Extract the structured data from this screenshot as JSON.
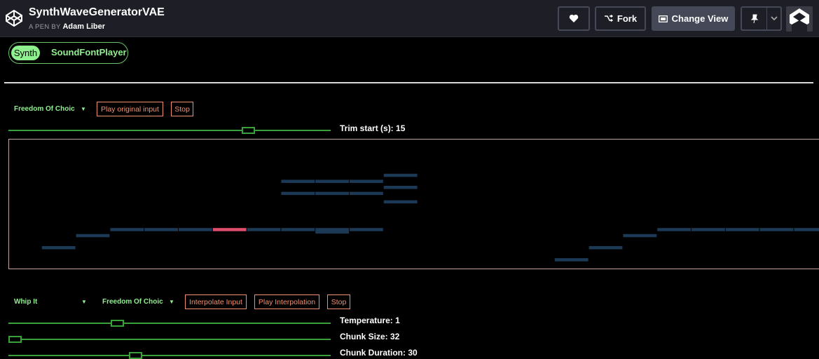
{
  "header": {
    "title": "SynthWaveGeneratorVAE",
    "byline_prefix": "A PEN BY",
    "author": "Adam Liber",
    "fork_label": "Fork",
    "change_view_label": "Change View"
  },
  "tabs": [
    {
      "label": "Synth",
      "active": true
    },
    {
      "label": "SoundFontPlayer",
      "active": false
    }
  ],
  "input_section": {
    "song_select": "Freedom Of Choic",
    "play_button": "Play original input",
    "stop_button": "Stop",
    "trim_label": "Trim start (s): 15",
    "trim_value": 15
  },
  "piano_roll": {
    "note_color": "#1c3a56",
    "highlight_color": "#e0506c",
    "notes": [
      {
        "start": 1,
        "dur": 1,
        "row": 15
      },
      {
        "start": 2,
        "dur": 1,
        "row": 13
      },
      {
        "start": 3,
        "dur": 1,
        "row": 12
      },
      {
        "start": 4,
        "dur": 1,
        "row": 12
      },
      {
        "start": 5,
        "dur": 1,
        "row": 12
      },
      {
        "start": 6,
        "dur": 1,
        "row": 12,
        "highlight": true
      },
      {
        "start": 7,
        "dur": 1,
        "row": 12
      },
      {
        "start": 8,
        "dur": 1,
        "row": 12
      },
      {
        "start": 9,
        "dur": 1,
        "row": 12
      },
      {
        "start": 9,
        "dur": 1,
        "row": 12.4
      },
      {
        "start": 10,
        "dur": 1,
        "row": 12
      },
      {
        "start": 8,
        "dur": 1,
        "row": 4
      },
      {
        "start": 9,
        "dur": 1,
        "row": 4
      },
      {
        "start": 10,
        "dur": 1,
        "row": 4
      },
      {
        "start": 8,
        "dur": 1,
        "row": 6
      },
      {
        "start": 9,
        "dur": 1,
        "row": 6
      },
      {
        "start": 10,
        "dur": 1,
        "row": 6
      },
      {
        "start": 11,
        "dur": 1,
        "row": 3
      },
      {
        "start": 11,
        "dur": 1,
        "row": 5
      },
      {
        "start": 11,
        "dur": 1,
        "row": 7.4
      },
      {
        "start": 16,
        "dur": 1,
        "row": 17
      },
      {
        "start": 17,
        "dur": 1,
        "row": 15
      },
      {
        "start": 18,
        "dur": 1,
        "row": 13
      },
      {
        "start": 19,
        "dur": 1,
        "row": 12
      },
      {
        "start": 20,
        "dur": 1,
        "row": 12
      },
      {
        "start": 21,
        "dur": 1,
        "row": 12
      },
      {
        "start": 22,
        "dur": 1,
        "row": 12
      },
      {
        "start": 23,
        "dur": 1,
        "row": 12
      }
    ]
  },
  "interp_section": {
    "song_a": "Whip It",
    "song_b": "Freedom Of Choic",
    "interpolate_button": "Interpolate Input",
    "play_button": "Play Interpolation",
    "stop_button": "Stop",
    "temperature_label": "Temperature: 1",
    "temperature_value": 0.33,
    "chunk_size_label": "Chunk Size: 32",
    "chunk_size_value": 0.0,
    "chunk_duration_label": "Chunk Duration: 30",
    "chunk_duration_value": 0.39
  },
  "icons": {
    "logo": "codepen-logo-icon",
    "heart": "heart-icon",
    "fork": "fork-icon",
    "change_view": "layout-icon",
    "pin": "pin-icon",
    "dropdown": "chevron-down-icon"
  }
}
